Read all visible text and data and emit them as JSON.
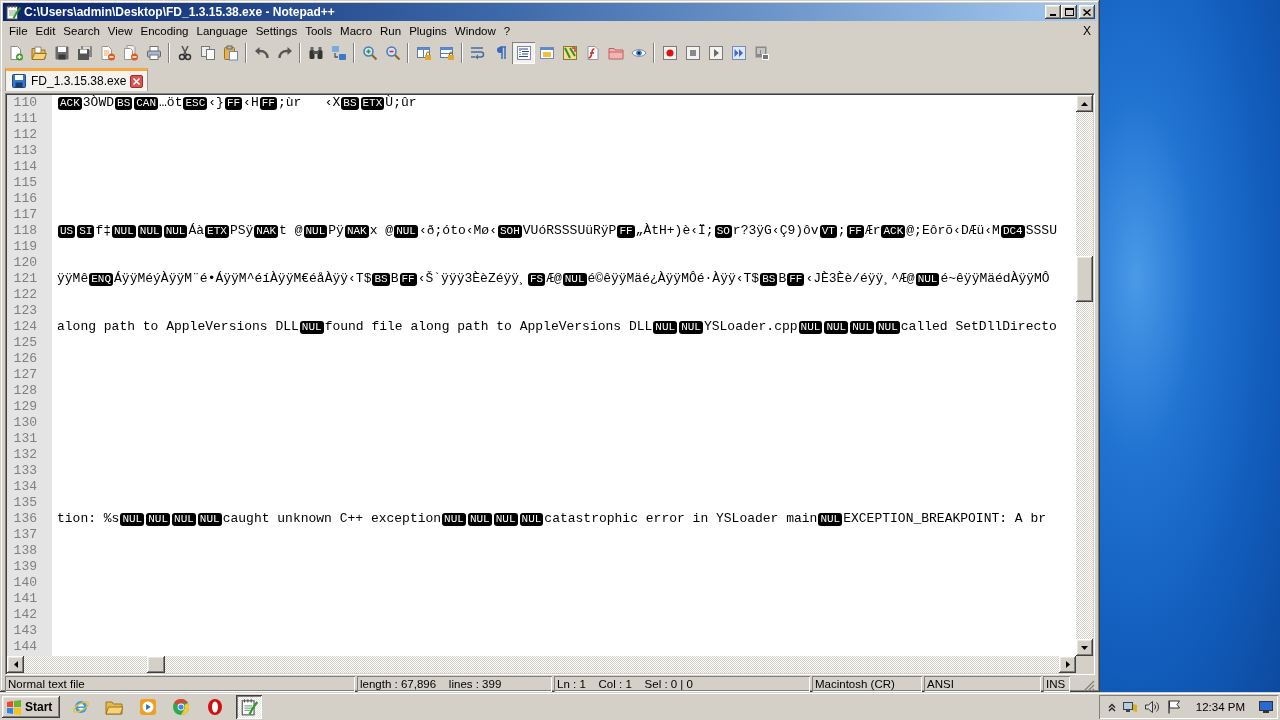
{
  "window": {
    "title": "C:\\Users\\admin\\Desktop\\FD_1.3.15.38.exe - Notepad++"
  },
  "menu": {
    "items": [
      "File",
      "Edit",
      "Search",
      "View",
      "Encoding",
      "Language",
      "Settings",
      "Tools",
      "Macro",
      "Run",
      "Plugins",
      "Window",
      "?"
    ],
    "close_label": "X"
  },
  "toolbar": {
    "groups": [
      {
        "buttons": [
          {
            "kind": "new",
            "pressed": false
          },
          {
            "kind": "open",
            "pressed": false
          },
          {
            "kind": "save",
            "pressed": false
          },
          {
            "kind": "saveall",
            "pressed": false
          },
          {
            "kind": "close",
            "pressed": false
          },
          {
            "kind": "closeall",
            "pressed": false
          },
          {
            "kind": "print",
            "pressed": false
          }
        ]
      },
      {
        "buttons": [
          {
            "kind": "cut",
            "pressed": false
          },
          {
            "kind": "copy",
            "pressed": false
          },
          {
            "kind": "paste",
            "pressed": false
          }
        ]
      },
      {
        "buttons": [
          {
            "kind": "undo",
            "pressed": false
          },
          {
            "kind": "redo",
            "pressed": false
          }
        ]
      },
      {
        "buttons": [
          {
            "kind": "find",
            "pressed": false
          },
          {
            "kind": "replace",
            "pressed": false
          }
        ]
      },
      {
        "buttons": [
          {
            "kind": "zoomin",
            "pressed": false
          },
          {
            "kind": "zoomout",
            "pressed": false
          }
        ]
      },
      {
        "buttons": [
          {
            "kind": "syncv",
            "pressed": false
          },
          {
            "kind": "synch",
            "pressed": false
          }
        ]
      },
      {
        "buttons": [
          {
            "kind": "wrap",
            "pressed": false
          },
          {
            "kind": "allchars",
            "pressed": false
          },
          {
            "kind": "indent",
            "pressed": true
          },
          {
            "kind": "udl",
            "pressed": false
          },
          {
            "kind": "docmap",
            "pressed": false
          },
          {
            "kind": "funclist",
            "pressed": false
          },
          {
            "kind": "workspace",
            "pressed": false
          },
          {
            "kind": "monitor",
            "pressed": false
          }
        ]
      },
      {
        "buttons": [
          {
            "kind": "record",
            "pressed": false
          },
          {
            "kind": "stop",
            "pressed": false
          },
          {
            "kind": "play",
            "pressed": false
          },
          {
            "kind": "playmulti",
            "pressed": false
          },
          {
            "kind": "savemacro",
            "pressed": false
          }
        ]
      }
    ]
  },
  "tabs": [
    {
      "label": "FD_1.3.15.38.exe",
      "selected": true
    }
  ],
  "editor": {
    "lines": [
      {
        "number": "110",
        "segments": [
          {
            "kind": "control",
            "text": "ACK"
          },
          {
            "kind": "text",
            "text": "3ÒWD"
          },
          {
            "kind": "control",
            "text": "BS"
          },
          {
            "kind": "control",
            "text": "CAN"
          },
          {
            "kind": "text",
            "text": "…öt"
          },
          {
            "kind": "control",
            "text": "ESC"
          },
          {
            "kind": "text",
            "text": "‹}"
          },
          {
            "kind": "control",
            "text": "FF"
          },
          {
            "kind": "text",
            "text": "‹H"
          },
          {
            "kind": "control",
            "text": "FF"
          },
          {
            "kind": "text",
            "text": ";ùr   ‹X"
          },
          {
            "kind": "control",
            "text": "BS"
          },
          {
            "kind": "control",
            "text": "ETX"
          },
          {
            "kind": "text",
            "text": "Ù;ûr"
          }
        ]
      },
      {
        "number": "111"
      },
      {
        "number": "112"
      },
      {
        "number": "113"
      },
      {
        "number": "114"
      },
      {
        "number": "115"
      },
      {
        "number": "116"
      },
      {
        "number": "117"
      },
      {
        "number": "118",
        "segments": [
          {
            "kind": "control",
            "text": "US"
          },
          {
            "kind": "control",
            "text": "SI"
          },
          {
            "kind": "text",
            "text": "f‡"
          },
          {
            "kind": "control",
            "text": "NUL"
          },
          {
            "kind": "control",
            "text": "NUL"
          },
          {
            "kind": "control",
            "text": "NUL"
          },
          {
            "kind": "text",
            "text": "Áà"
          },
          {
            "kind": "control",
            "text": "ETX"
          },
          {
            "kind": "text",
            "text": "PSÿ"
          },
          {
            "kind": "control",
            "text": "NAK"
          },
          {
            "kind": "text",
            "text": "t @"
          },
          {
            "kind": "control",
            "text": "NUL"
          },
          {
            "kind": "text",
            "text": "Pÿ"
          },
          {
            "kind": "control",
            "text": "NAK"
          },
          {
            "kind": "text",
            "text": "x @"
          },
          {
            "kind": "control",
            "text": "NUL"
          },
          {
            "kind": "text",
            "text": "‹ð;óto‹Mø‹"
          },
          {
            "kind": "control",
            "text": "SOH"
          },
          {
            "kind": "text",
            "text": "VUóRSSSUüRÿP"
          },
          {
            "kind": "control",
            "text": "FF"
          },
          {
            "kind": "text",
            "text": "„ÀtH+)è‹Ï;"
          },
          {
            "kind": "control",
            "text": "SO"
          },
          {
            "kind": "text",
            "text": "r?3ÿG‹Ç9)ôv"
          },
          {
            "kind": "control",
            "text": "VT"
          },
          {
            "kind": "text",
            "text": ";"
          },
          {
            "kind": "control",
            "text": "FF"
          },
          {
            "kind": "text",
            "text": "Ær"
          },
          {
            "kind": "control",
            "text": "ACK"
          },
          {
            "kind": "text",
            "text": "@;Eôrõ‹DÆü‹M"
          },
          {
            "kind": "control",
            "text": "DC4"
          },
          {
            "kind": "text",
            "text": "SSSU"
          }
        ]
      },
      {
        "number": "119"
      },
      {
        "number": "120"
      },
      {
        "number": "121",
        "segments": [
          {
            "kind": "text",
            "text": "ÿÿMê"
          },
          {
            "kind": "control",
            "text": "ENQ"
          },
          {
            "kind": "text",
            "text": "ÁÿÿMéýÀÿÿM¨é•ÁÿÿM^éíÀÿÿM€éåÀÿÿ‹T$"
          },
          {
            "kind": "control",
            "text": "BS"
          },
          {
            "kind": "text",
            "text": "B"
          },
          {
            "kind": "control",
            "text": "FF"
          },
          {
            "kind": "text",
            "text": "‹Š`ÿÿÿ3ÈèZéÿÿ¸"
          },
          {
            "kind": "control",
            "text": "FS"
          },
          {
            "kind": "text",
            "text": "Æ@"
          },
          {
            "kind": "control",
            "text": "NUL"
          },
          {
            "kind": "text",
            "text": "é©êÿÿMäé¿ÀÿÿMÔé·Àÿÿ‹T$"
          },
          {
            "kind": "control",
            "text": "BS"
          },
          {
            "kind": "text",
            "text": "B"
          },
          {
            "kind": "control",
            "text": "FF"
          },
          {
            "kind": "text",
            "text": "‹JÈ3Èè/éÿÿ¸^Æ@"
          },
          {
            "kind": "control",
            "text": "NUL"
          },
          {
            "kind": "text",
            "text": "é~êÿÿMäédÀÿÿMÔ"
          }
        ]
      },
      {
        "number": "122"
      },
      {
        "number": "123"
      },
      {
        "number": "124",
        "segments": [
          {
            "kind": "text",
            "text": "along path to AppleVersions DLL"
          },
          {
            "kind": "control",
            "text": "NUL"
          },
          {
            "kind": "text",
            "text": "found file along path to AppleVersions DLL"
          },
          {
            "kind": "control",
            "text": "NUL"
          },
          {
            "kind": "control",
            "text": "NUL"
          },
          {
            "kind": "text",
            "text": "YSLoader.cpp"
          },
          {
            "kind": "control",
            "text": "NUL"
          },
          {
            "kind": "control",
            "text": "NUL"
          },
          {
            "kind": "control",
            "text": "NUL"
          },
          {
            "kind": "control",
            "text": "NUL"
          },
          {
            "kind": "text",
            "text": "called SetDllDirecto"
          }
        ]
      },
      {
        "number": "125"
      },
      {
        "number": "126"
      },
      {
        "number": "127"
      },
      {
        "number": "128"
      },
      {
        "number": "129"
      },
      {
        "number": "130"
      },
      {
        "number": "131"
      },
      {
        "number": "132"
      },
      {
        "number": "133"
      },
      {
        "number": "134"
      },
      {
        "number": "135"
      },
      {
        "number": "136",
        "segments": [
          {
            "kind": "text",
            "text": "tion: %s"
          },
          {
            "kind": "control",
            "text": "NUL"
          },
          {
            "kind": "control",
            "text": "NUL"
          },
          {
            "kind": "control",
            "text": "NUL"
          },
          {
            "kind": "control",
            "text": "NUL"
          },
          {
            "kind": "text",
            "text": "caught unknown C++ exception"
          },
          {
            "kind": "control",
            "text": "NUL"
          },
          {
            "kind": "control",
            "text": "NUL"
          },
          {
            "kind": "control",
            "text": "NUL"
          },
          {
            "kind": "control",
            "text": "NUL"
          },
          {
            "kind": "text",
            "text": "catastrophic error in YSLoader main"
          },
          {
            "kind": "control",
            "text": "NUL"
          },
          {
            "kind": "text",
            "text": "EXCEPTION_BREAKPOINT: A br"
          }
        ]
      },
      {
        "number": "137"
      },
      {
        "number": "138"
      },
      {
        "number": "139"
      },
      {
        "number": "140"
      },
      {
        "number": "141"
      },
      {
        "number": "142"
      },
      {
        "number": "143"
      },
      {
        "number": "144"
      }
    ]
  },
  "status_bar": {
    "cells": [
      "Normal text file",
      "length : 67,896    lines : 399",
      "Ln : 1    Col : 1    Sel : 0 | 0",
      "Macintosh (CR)",
      "ANSI",
      "INS"
    ]
  },
  "taskbar": {
    "start_label": "Start",
    "apps": [
      {
        "kind": "globe",
        "active": false
      },
      {
        "kind": "folder",
        "active": false
      },
      {
        "kind": "media",
        "active": false
      },
      {
        "kind": "tricolor",
        "active": false
      },
      {
        "kind": "redring",
        "active": false
      },
      {
        "kind": "notepad",
        "active": true
      }
    ],
    "clock": "12:34 PM"
  }
}
